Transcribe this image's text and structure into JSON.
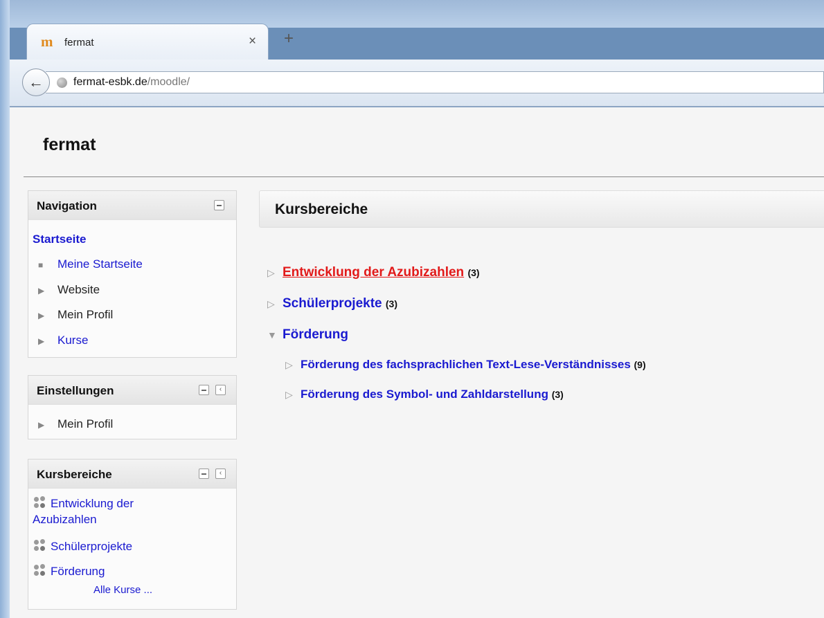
{
  "browser": {
    "tab_title": "fermat",
    "tab_icon": "moodle-icon",
    "close_glyph": "×",
    "newtab_glyph": "+",
    "back_glyph": "←",
    "url_host": "fermat-esbk.de",
    "url_path": "/moodle/"
  },
  "site": {
    "title": "fermat"
  },
  "navigation": {
    "title": "Navigation",
    "home": "Startseite",
    "items": [
      {
        "label": "Meine Startseite"
      },
      {
        "label": "Website"
      },
      {
        "label": "Mein Profil"
      },
      {
        "label": "Kurse"
      }
    ]
  },
  "settings": {
    "title": "Einstellungen",
    "items": [
      {
        "label": "Mein Profil"
      }
    ]
  },
  "course_block": {
    "title": "Kursbereiche",
    "items": [
      {
        "label": "Entwicklung der",
        "label2": "Azubizahlen"
      },
      {
        "label": "Schülerprojekte"
      },
      {
        "label": "Förderung"
      }
    ],
    "all_courses": "Alle Kurse ..."
  },
  "main": {
    "title": "Kursbereiche",
    "categories": [
      {
        "name": "Entwicklung der Azubizahlen",
        "count": "(3)"
      },
      {
        "name": "Schülerprojekte",
        "count": "(3)"
      },
      {
        "name": "Förderung",
        "count": ""
      },
      {
        "name": "Förderung des fachsprachlichen Text-Lese-Verständnisses",
        "count": "(9)"
      },
      {
        "name": "Förderung des Symbol- und Zahldarstellung",
        "count": "(3)"
      }
    ]
  },
  "colors": {
    "link": "#1a1ad0",
    "active_link": "#e21a1a"
  }
}
